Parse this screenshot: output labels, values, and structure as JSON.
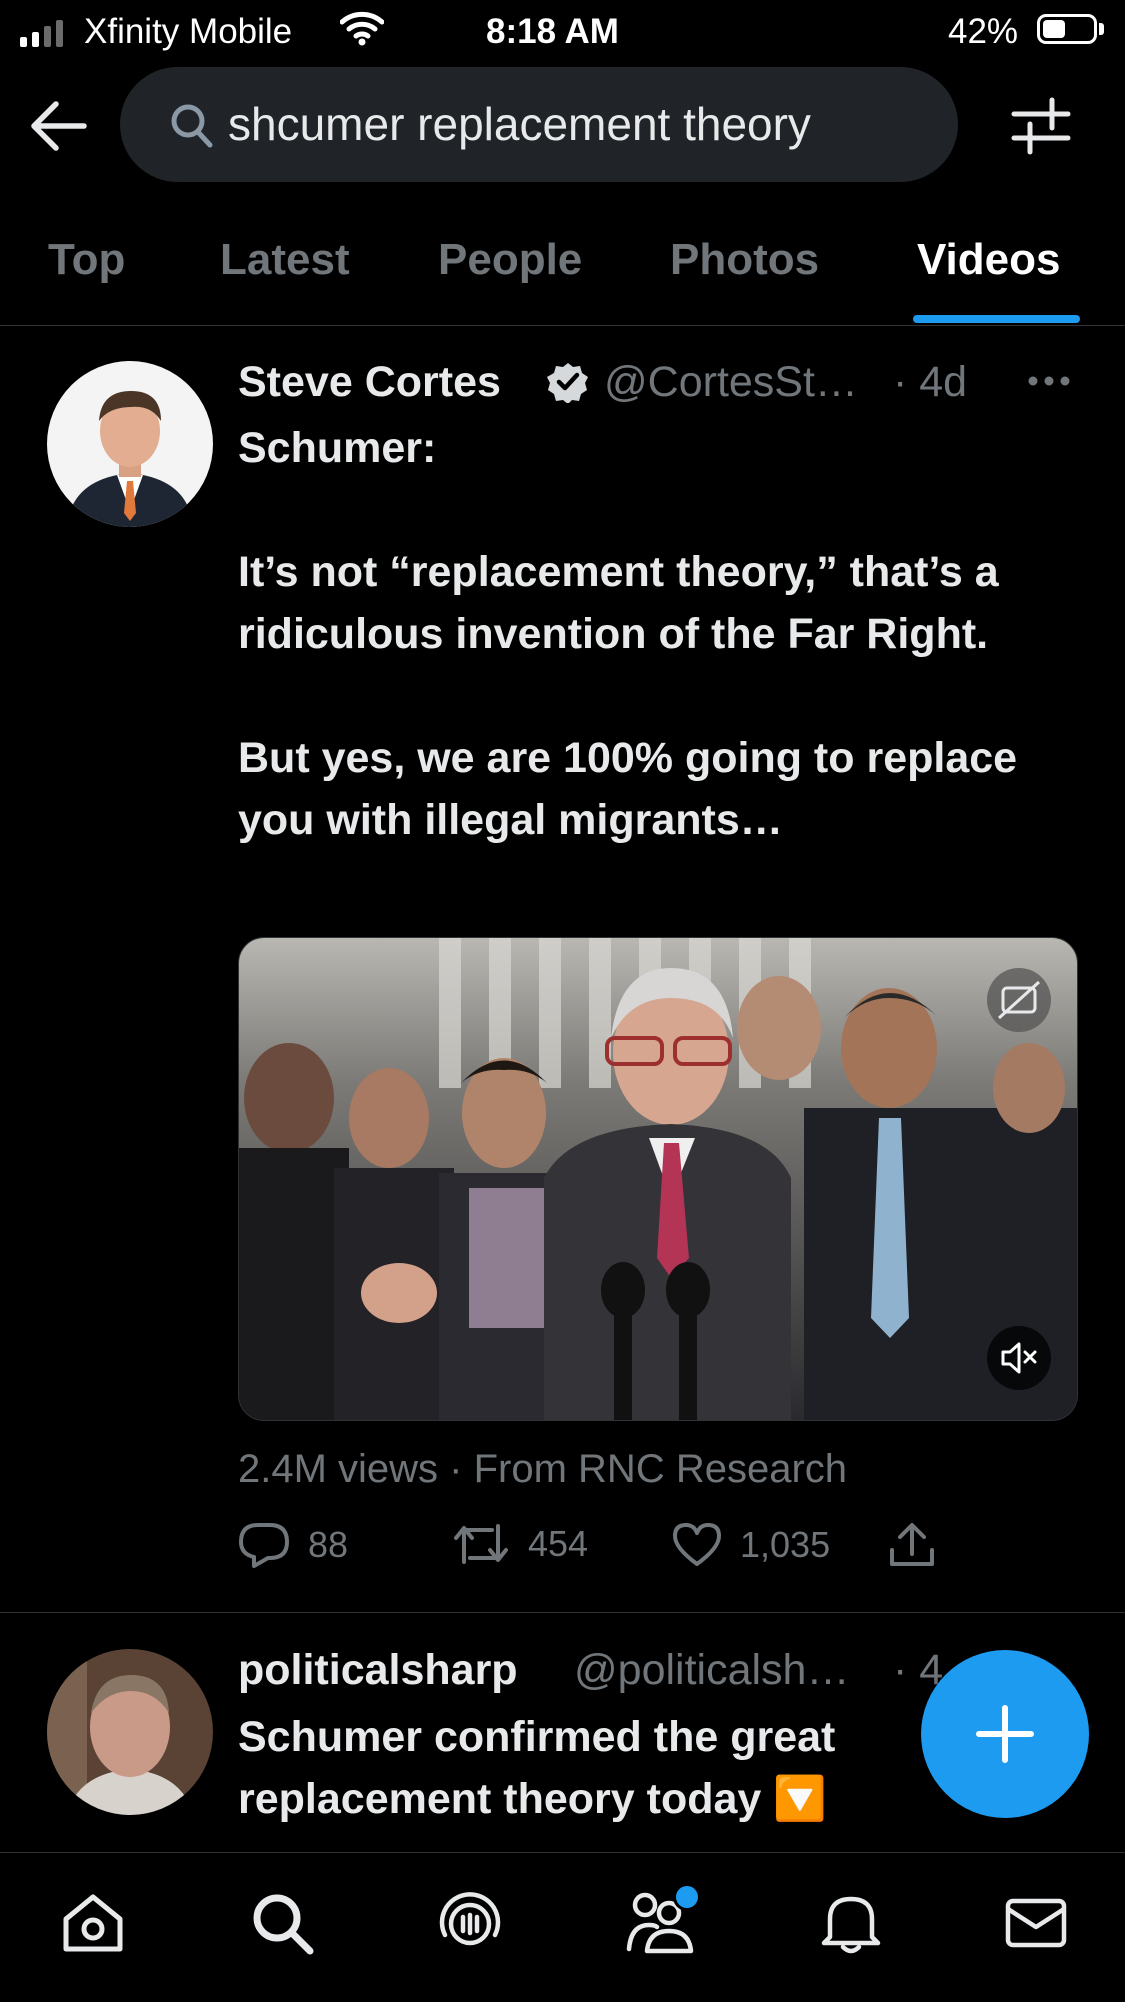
{
  "status_bar": {
    "carrier": "Xfinity Mobile",
    "time": "8:18 AM",
    "battery": "42%",
    "battery_level": 0.42,
    "signal_bars": 2
  },
  "search": {
    "query": "shcumer replacement theory",
    "back_icon": "arrow-left-icon",
    "filter_icon": "sliders-icon"
  },
  "tabs": [
    {
      "label": "Top",
      "active": false
    },
    {
      "label": "Latest",
      "active": false
    },
    {
      "label": "People",
      "active": false
    },
    {
      "label": "Photos",
      "active": false
    },
    {
      "label": "Videos",
      "active": true
    }
  ],
  "tweets": [
    {
      "name": "Steve Cortes",
      "verified": true,
      "handle": "@CortesSt…",
      "time": "· 4d",
      "text": "Schumer:\n\nIt’s not “replacement theory,” that’s a ridiculous invention of the Far Right.\n\nBut yes, we are 100% going to replace you with illegal migrants…",
      "meta": "2.4M views · From RNC Research",
      "replies": "88",
      "retweets": "454",
      "likes": "1,035"
    },
    {
      "name": "politicalsharp",
      "handle": "@politicalsh…",
      "time": "· 4",
      "text": "Schumer confirmed the great replacement theory today 🔽"
    }
  ],
  "colors": {
    "accent": "#1d9bf0",
    "background": "#000000",
    "muted": "#71767b",
    "text": "#e7e9ea"
  },
  "bottom_nav": [
    {
      "icon": "home-icon"
    },
    {
      "icon": "search-icon"
    },
    {
      "icon": "spaces-icon"
    },
    {
      "icon": "communities-icon",
      "badge": true
    },
    {
      "icon": "bell-icon"
    },
    {
      "icon": "mail-icon"
    }
  ]
}
